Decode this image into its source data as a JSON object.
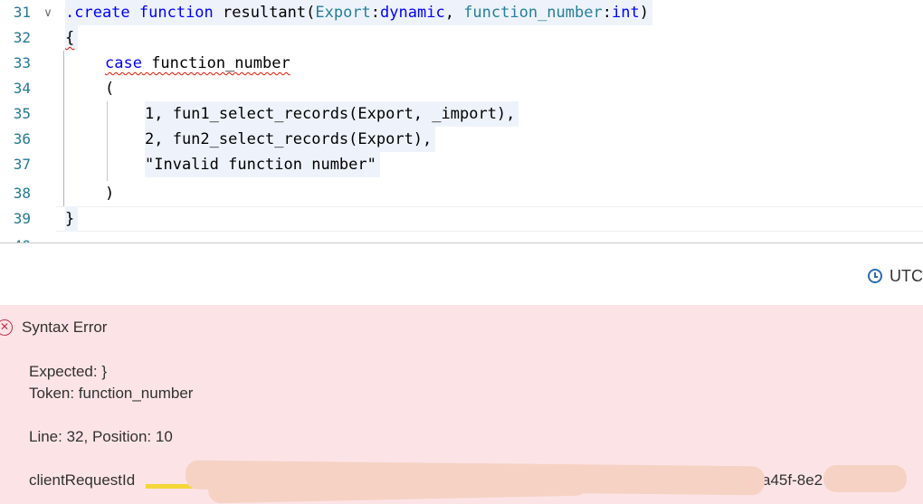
{
  "editor": {
    "lines": [
      {
        "num": "31",
        "fold": "∨",
        "parts": [
          {
            "t": ".create ",
            "c": "kw"
          },
          {
            "t": "function ",
            "c": "kw"
          },
          {
            "t": "resultant(",
            "c": ""
          },
          {
            "t": "Export",
            "c": "tp"
          },
          {
            "t": ":",
            "c": ""
          },
          {
            "t": "dynamic",
            "c": "kw"
          },
          {
            "t": ", ",
            "c": ""
          },
          {
            "t": "function_number",
            "c": "tp"
          },
          {
            "t": ":",
            "c": ""
          },
          {
            "t": "int",
            "c": "kw"
          },
          {
            "t": ")",
            "c": ""
          }
        ]
      },
      {
        "num": "32",
        "text": "{"
      },
      {
        "num": "33",
        "kw": "case",
        "rest": " function_number"
      },
      {
        "num": "34",
        "text": "("
      },
      {
        "num": "35",
        "text": "1, fun1_select_records(Export, _import),"
      },
      {
        "num": "36",
        "text": "2, fun2_select_records(Export),"
      },
      {
        "num": "37",
        "text": "\"Invalid function number\""
      },
      {
        "num": "38",
        "text": ")"
      },
      {
        "num": "39",
        "text": "}"
      }
    ]
  },
  "timezone": {
    "label": "UTC",
    "icon": "clock-icon"
  },
  "error": {
    "title": "Syntax Error",
    "expected": "Expected: }",
    "token": "Token: function_number",
    "position": "Line: 32, Position: 10",
    "client_request_prefix": "clientRequestId",
    "client_request_fragment": "a45f-8e2",
    "icon": "error-circle-icon",
    "color": "#c4314b",
    "background": "#fce4e6"
  }
}
